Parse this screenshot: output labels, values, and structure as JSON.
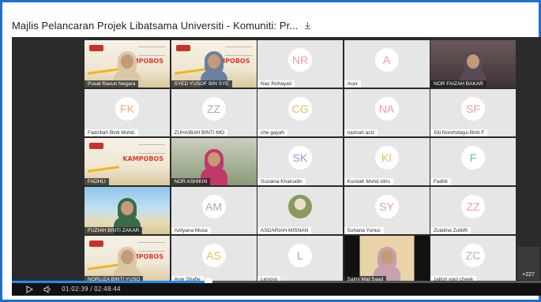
{
  "window": {
    "title": "Majlis Pelancaran Projek Libatsama Universiti - Komuniti: Pr...",
    "download_icon": "download-icon"
  },
  "participants": [
    {
      "name": "Pusat Racun Negara",
      "type": "banner-person",
      "color": "#d8c8a8"
    },
    {
      "name": "SYED YUSOF BIN SYE",
      "type": "banner-person",
      "color": "#6b7fa0"
    },
    {
      "name": "Nas Rohayati",
      "type": "initials",
      "initials": "NR",
      "color": "#e8a0a0"
    },
    {
      "name": "Acer",
      "type": "initials",
      "initials": "A",
      "color": "#e8a0a0"
    },
    {
      "name": "NOR FAIZAH BAKAR",
      "type": "camera",
      "color": "#5a4a55"
    },
    {
      "name": "Fadzillah Binti Mohd.",
      "type": "initials",
      "initials": "FK",
      "color": "#e8b07a"
    },
    {
      "name": "ZUHAIBAH BINTI MO",
      "type": "initials",
      "initials": "ZZ",
      "color": "#aaaaaa"
    },
    {
      "name": "che gayah",
      "type": "initials",
      "initials": "CG",
      "color": "#d8c65a"
    },
    {
      "name": "nazirah aziz",
      "type": "initials",
      "initials": "NA",
      "color": "#e8a0a0"
    },
    {
      "name": "Siti Noorhidayu Binti F",
      "type": "initials",
      "initials": "SF",
      "color": "#e8a0a0"
    },
    {
      "name": "FADHLI",
      "type": "banner",
      "color": "#d8c8a8"
    },
    {
      "name": "NOR ASHIKIN",
      "type": "camera",
      "color": "#c0396b"
    },
    {
      "name": "Suzaina Khairudin",
      "type": "initials",
      "initials": "SK",
      "color": "#b08ad0"
    },
    {
      "name": "Kursiah Mohd Idris",
      "type": "initials",
      "initials": "KI",
      "color": "#e8c04a"
    },
    {
      "name": "Fadhli",
      "type": "initials",
      "initials": "F",
      "color": "#6ac08a"
    },
    {
      "name": "FUZIAH BINTI ZAKAR",
      "type": "beach",
      "color": "#3a6a4a"
    },
    {
      "name": "Azliyana Musa",
      "type": "initials",
      "initials": "AM",
      "color": "#aaaaaa"
    },
    {
      "name": "ASDARIAH MISNAN",
      "type": "photo-avatar",
      "color": "#8a9a5a"
    },
    {
      "name": "Suhana Yunus",
      "type": "initials",
      "initials": "SY",
      "color": "#e8a0a0"
    },
    {
      "name": "Zulalina Zulkifli",
      "type": "initials",
      "initials": "ZZ",
      "color": "#e8a0a0"
    },
    {
      "name": "NORLIZA BINTI YUSO",
      "type": "banner-person",
      "color": "#d8c8a8"
    },
    {
      "name": "Anie Shafie",
      "type": "initials",
      "initials": "AS",
      "color": "#e8c04a"
    },
    {
      "name": "Lenovo",
      "type": "initials",
      "initials": "L",
      "color": "#6ac08a"
    },
    {
      "name": "Salmi Mat Saad",
      "type": "camera-dark",
      "color": "#c9a0b0"
    },
    {
      "name": "zalton wan cheek",
      "type": "initials",
      "initials": "ZC",
      "color": "#aab8cc"
    }
  ],
  "more_count": "+227",
  "player": {
    "current_time": "01:02:39",
    "duration": "02:48:44",
    "time_display": "01:02:39 / 02:48:44",
    "progress_fraction": 0.371,
    "play_icon": "play-icon",
    "volume_icon": "volume-icon",
    "accent": "#1e8ef0"
  },
  "banner_brand": "KAMPOBOS"
}
